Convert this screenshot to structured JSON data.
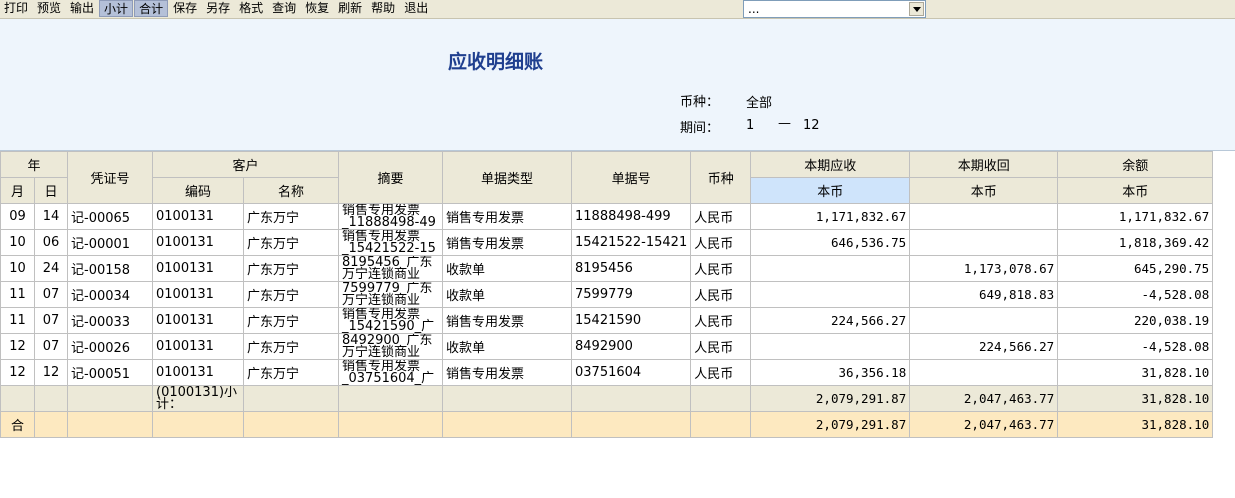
{
  "toolbar": {
    "buttons": [
      "打印",
      "预览",
      "输出",
      "小计",
      "合计",
      "保存",
      "另存",
      "格式",
      "查询",
      "恢复",
      "刷新",
      "帮助",
      "退出"
    ],
    "combo_value": "..."
  },
  "report": {
    "title": "应收明细账",
    "currency_label": "币种：",
    "currency_value": "全部",
    "period_label": "期间：",
    "period_from": "1",
    "period_sep": "—",
    "period_to": "12"
  },
  "columns": {
    "year": "年",
    "month": "月",
    "day": "日",
    "voucher": "凭证号",
    "customer": "客户",
    "code": "编码",
    "name": "名称",
    "summary": "摘要",
    "doc_type": "单据类型",
    "doc_no": "单据号",
    "currency": "币种",
    "receivable": "本期应收",
    "received": "本期收回",
    "balance": "余额",
    "local": "本币"
  },
  "rows": [
    {
      "m": "09",
      "d": "14",
      "voucher": "记-00065",
      "code": "0100131",
      "name": "广东万宁",
      "summary": "销售专用发票_11888498-49",
      "type": "销售专用发票",
      "no": "11888498-499",
      "cur": "人民币",
      "recv": "1,171,832.67",
      "got": "",
      "bal": "1,171,832.67"
    },
    {
      "m": "10",
      "d": "06",
      "voucher": "记-00001",
      "code": "0100131",
      "name": "广东万宁",
      "summary": "销售专用发票_15421522-15",
      "type": "销售专用发票",
      "no": "15421522-15421",
      "cur": "人民币",
      "recv": "646,536.75",
      "got": "",
      "bal": "1,818,369.42"
    },
    {
      "m": "10",
      "d": "24",
      "voucher": "记-00158",
      "code": "0100131",
      "name": "广东万宁",
      "summary": "8195456_广东万宁连锁商业",
      "type": "收款单",
      "no": "8195456",
      "cur": "人民币",
      "recv": "",
      "got": "1,173,078.67",
      "bal": "645,290.75"
    },
    {
      "m": "11",
      "d": "07",
      "voucher": "记-00034",
      "code": "0100131",
      "name": "广东万宁",
      "summary": "7599779_广东万宁连锁商业",
      "type": "收款单",
      "no": "7599779",
      "cur": "人民币",
      "recv": "",
      "got": "649,818.83",
      "bal": "-4,528.08"
    },
    {
      "m": "11",
      "d": "07",
      "voucher": "记-00033",
      "code": "0100131",
      "name": "广东万宁",
      "summary": "销售专用发票_15421590_广",
      "type": "销售专用发票",
      "no": "15421590",
      "cur": "人民币",
      "recv": "224,566.27",
      "got": "",
      "bal": "220,038.19"
    },
    {
      "m": "12",
      "d": "07",
      "voucher": "记-00026",
      "code": "0100131",
      "name": "广东万宁",
      "summary": "8492900_广东万宁连锁商业",
      "type": "收款单",
      "no": "8492900",
      "cur": "人民币",
      "recv": "",
      "got": "224,566.27",
      "bal": "-4,528.08"
    },
    {
      "m": "12",
      "d": "12",
      "voucher": "记-00051",
      "code": "0100131",
      "name": "广东万宁",
      "summary": "销售专用发票_03751604_广",
      "type": "销售专用发票",
      "no": "03751604",
      "cur": "人民币",
      "recv": "36,356.18",
      "got": "",
      "bal": "31,828.10"
    }
  ],
  "subtotal": {
    "label": "(0100131)小计：",
    "recv": "2,079,291.87",
    "got": "2,047,463.77",
    "bal": "31,828.10"
  },
  "total": {
    "label": "合",
    "recv": "2,079,291.87",
    "got": "2,047,463.77",
    "bal": "31,828.10"
  }
}
